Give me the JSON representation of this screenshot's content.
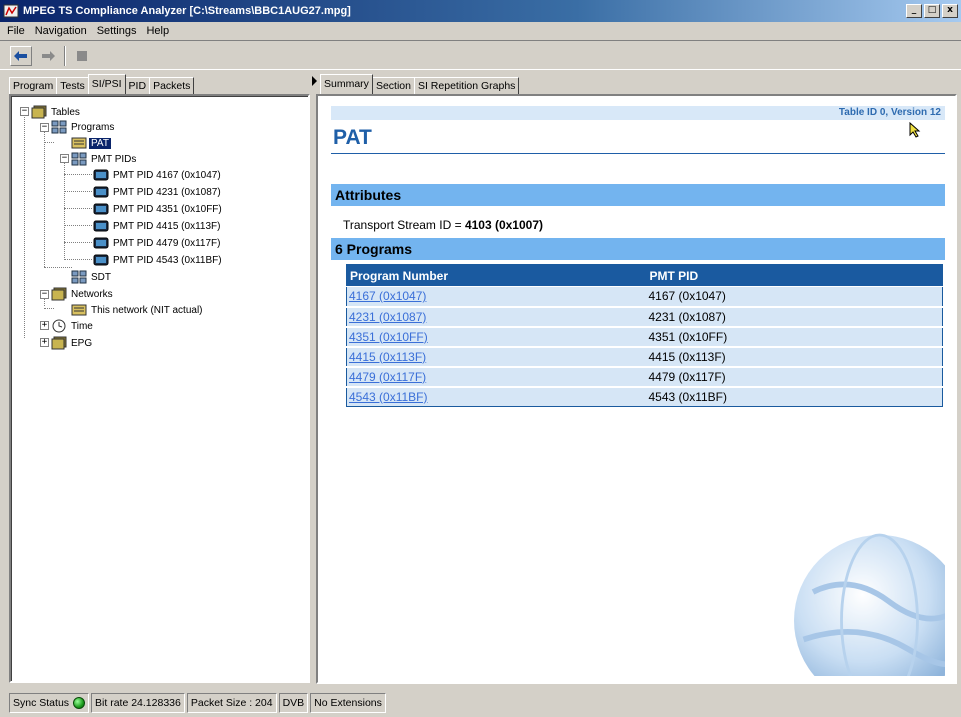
{
  "window": {
    "title": "MPEG TS Compliance Analyzer [C:\\Streams\\BBC1AUG27.mpg]",
    "buttons": {
      "minimize": "_",
      "maximize": "□",
      "close": "x"
    }
  },
  "menu": [
    "File",
    "Navigation",
    "Settings",
    "Help"
  ],
  "toolbar": {
    "back_icon": "back-arrow-icon",
    "forward_icon": "forward-arrow-icon",
    "stop_icon": "stop-icon"
  },
  "left_tabs": [
    "Program",
    "Tests",
    "SI/PSI",
    "PID",
    "Packets"
  ],
  "left_tabs_active": "SI/PSI",
  "tree": {
    "tables": "Tables",
    "programs": "Programs",
    "pat": "PAT",
    "pmt_pids": "PMT PIDs",
    "pmt_items": [
      "PMT PID 4167 (0x1047)",
      "PMT PID 4231 (0x1087)",
      "PMT PID 4351 (0x10FF)",
      "PMT PID 4415 (0x113F)",
      "PMT PID 4479 (0x117F)",
      "PMT PID 4543 (0x11BF)"
    ],
    "sdt": "SDT",
    "networks": "Networks",
    "this_network": "This network (NIT actual)",
    "time": "Time",
    "epg": "EPG"
  },
  "right_tabs": [
    "Summary",
    "Section",
    "SI Repetition Graphs"
  ],
  "right_tabs_active": "Summary",
  "content": {
    "table_id": "Table ID 0, Version 12",
    "title": "PAT",
    "attributes_header": "Attributes",
    "ts_id_label": "Transport Stream ID = ",
    "ts_id_value": "4103 (0x1007)",
    "programs_header": "6 Programs",
    "columns": [
      "Program Number",
      "PMT PID"
    ],
    "rows": [
      [
        "4167 (0x1047)",
        "4167 (0x1047)"
      ],
      [
        "4231 (0x1087)",
        "4231 (0x1087)"
      ],
      [
        "4351 (0x10FF)",
        "4351 (0x10FF)"
      ],
      [
        "4415 (0x113F)",
        "4415 (0x113F)"
      ],
      [
        "4479 (0x117F)",
        "4479 (0x117F)"
      ],
      [
        "4543 (0x11BF)",
        "4543 (0x11BF)"
      ]
    ]
  },
  "status": {
    "sync": "Sync Status",
    "bitrate": "Bit rate 24.128336",
    "packet_size": "Packet Size : 204",
    "standard": "DVB",
    "extensions": "No Extensions"
  },
  "colors": {
    "accent": "#1f5fa8",
    "section_bar": "#73b4ef",
    "table_header": "#1a5aa0",
    "row_bg": "#d6e6f6",
    "sync_ok": "#1c9b1c"
  }
}
